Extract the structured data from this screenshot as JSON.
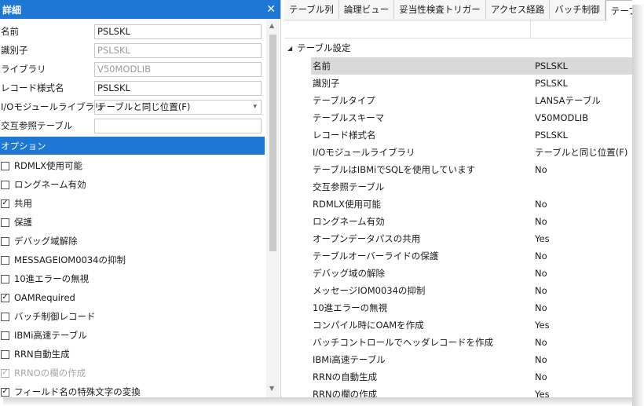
{
  "details_panel": {
    "title": "詳細",
    "close_glyph": "✕",
    "fields": [
      {
        "label": "名前",
        "value": "PSLSKL",
        "dim": false,
        "select": false
      },
      {
        "label": "識別子",
        "value": "PSLSKL",
        "dim": true,
        "select": false
      },
      {
        "label": "ライブラリ",
        "value": "V50MODLIB",
        "dim": true,
        "select": false
      },
      {
        "label": "レコード様式名",
        "value": "PSLSKL",
        "dim": false,
        "select": false
      },
      {
        "label": "I/Oモジュールライブラリ",
        "value": "テーブルと同じ位置(F)",
        "dim": false,
        "select": true
      },
      {
        "label": "交互参照テーブル",
        "value": "",
        "dim": false,
        "select": false
      }
    ],
    "options_header": "オプション",
    "options": [
      {
        "label": "RDMLX使用可能",
        "checked": false,
        "disabled": false
      },
      {
        "label": "ロングネーム有効",
        "checked": false,
        "disabled": false
      },
      {
        "label": "共用",
        "checked": true,
        "disabled": false
      },
      {
        "label": "保護",
        "checked": false,
        "disabled": false
      },
      {
        "label": "デバッグ域解除",
        "checked": false,
        "disabled": false
      },
      {
        "label": "MESSAGEIOM0034の抑制",
        "checked": false,
        "disabled": false
      },
      {
        "label": "10進エラーの無視",
        "checked": false,
        "disabled": false
      },
      {
        "label": "OAMRequired",
        "checked": true,
        "disabled": false
      },
      {
        "label": "バッチ制御レコード",
        "checked": false,
        "disabled": false
      },
      {
        "label": "IBMi高速テーブル",
        "checked": false,
        "disabled": false
      },
      {
        "label": "RRN自動生成",
        "checked": false,
        "disabled": false
      },
      {
        "label": "RRNOの欄の作成",
        "checked": true,
        "disabled": true
      },
      {
        "label": "フィールド名の特殊文字の変換",
        "checked": true,
        "disabled": false
      }
    ]
  },
  "tabs": [
    {
      "label": "テーブル列",
      "active": false
    },
    {
      "label": "論理ビュー",
      "active": false
    },
    {
      "label": "妥当性検査トリガー",
      "active": false
    },
    {
      "label": "アクセス経路",
      "active": false
    },
    {
      "label": "バッチ制御",
      "active": false
    },
    {
      "label": "テーブル属性",
      "active": true
    }
  ],
  "properties": {
    "section_title": "テーブル設定",
    "rows": [
      {
        "name": "名前",
        "value": "PSLSKL",
        "selected": true
      },
      {
        "name": "識別子",
        "value": "PSLSKL",
        "selected": false
      },
      {
        "name": "テーブルタイプ",
        "value": "LANSAテーブル",
        "selected": false
      },
      {
        "name": "テーブルスキーマ",
        "value": "V50MODLIB",
        "selected": false
      },
      {
        "name": "レコード様式名",
        "value": "PSLSKL",
        "selected": false
      },
      {
        "name": "I/Oモジュールライブラリ",
        "value": "テーブルと同じ位置(F)",
        "selected": false
      },
      {
        "name": "テーブルはIBMiでSQLを使用しています",
        "value": "No",
        "selected": false
      },
      {
        "name": "交互参照テーブル",
        "value": "",
        "selected": false
      },
      {
        "name": "RDMLX使用可能",
        "value": "No",
        "selected": false
      },
      {
        "name": "ロングネーム有効",
        "value": "No",
        "selected": false
      },
      {
        "name": "オープンデータパスの共用",
        "value": "Yes",
        "selected": false
      },
      {
        "name": "テーブルオーバーライドの保護",
        "value": "No",
        "selected": false
      },
      {
        "name": "デバッグ域の解除",
        "value": "No",
        "selected": false
      },
      {
        "name": "メッセージIOM0034の抑制",
        "value": "No",
        "selected": false
      },
      {
        "name": "10進エラーの無視",
        "value": "No",
        "selected": false
      },
      {
        "name": "コンパイル時にOAMを作成",
        "value": "Yes",
        "selected": false
      },
      {
        "name": "バッチコントロールでヘッダレコードを作成",
        "value": "No",
        "selected": false
      },
      {
        "name": "IBMi高速テーブル",
        "value": "No",
        "selected": false
      },
      {
        "name": "RRNの自動生成",
        "value": "No",
        "selected": false
      },
      {
        "name": "RRNの欄の作成",
        "value": "Yes",
        "selected": false
      }
    ]
  },
  "colors": {
    "accent": "#1e77d3",
    "selected_row": "#d9d9d9"
  }
}
